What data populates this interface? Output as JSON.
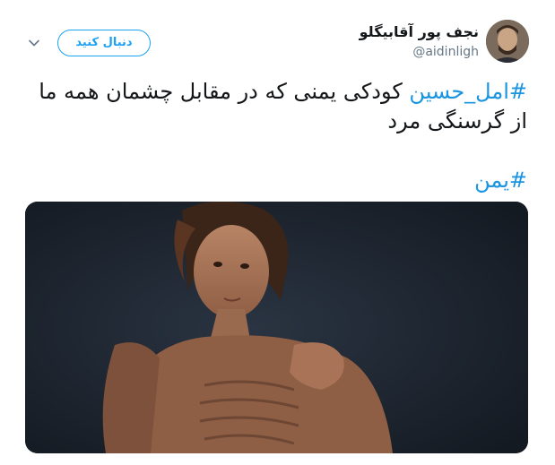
{
  "author": {
    "display_name": "نجف پور آقابیگلو",
    "handle": "@aidinligh",
    "avatar_icon": "user-avatar-photo"
  },
  "header": {
    "follow_label": "دنبال کنید",
    "menu_icon": "chevron-down-icon"
  },
  "tweet": {
    "hashtag_1": "#امل_حسین",
    "text_1": " کودکی یمنی که در مقابل چشمان همه ما از گرسنگی مرد",
    "hashtag_2": "#یمن"
  },
  "media": {
    "type": "photo"
  },
  "colors": {
    "accent": "#1da1f2",
    "hashtag": "#1b95e0",
    "text": "#14171a",
    "secondary_text": "#657786"
  }
}
